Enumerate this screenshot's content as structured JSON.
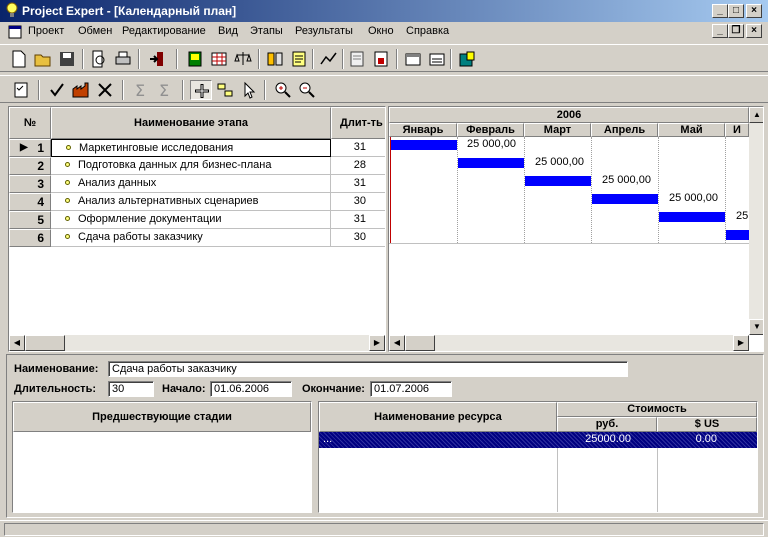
{
  "window": {
    "title": "Project Expert - [Календарный план]"
  },
  "menu": [
    "Проект",
    "Обмен",
    "Редактирование",
    "Вид",
    "Этапы",
    "Результаты",
    "Окно",
    "Справка"
  ],
  "toolbar1_icons": [
    "new-doc-icon",
    "open-folder-icon",
    "save-icon",
    "print-preview-icon",
    "print-icon",
    "import-icon",
    "module-icon",
    "calendar-grid-icon",
    "scales-icon",
    "calculator-icon",
    "notes-icon",
    "chart-icon",
    "report-icon",
    "report-red-icon",
    "window1-icon",
    "window2-icon",
    "database-icon"
  ],
  "toolbar2_icons": [
    "checklist-icon",
    "check-icon",
    "factory-icon",
    "delete-icon",
    "sum-icon",
    "sum2-icon",
    "add-stage-icon",
    "link-stage-icon",
    "pointer-icon",
    "zoom-in-icon",
    "zoom-out-icon"
  ],
  "grid": {
    "headers": {
      "num": "№",
      "name": "Наименование этапа",
      "duration": "Длит-ть"
    },
    "rows": [
      {
        "num": "1",
        "name": "Маркетинговые исследования",
        "duration": "31"
      },
      {
        "num": "2",
        "name": "Подготовка данных для бизнес-плана",
        "duration": "28"
      },
      {
        "num": "3",
        "name": "Анализ данных",
        "duration": "31"
      },
      {
        "num": "4",
        "name": "Анализ альтернативных сценариев",
        "duration": "30"
      },
      {
        "num": "5",
        "name": "Оформление документации",
        "duration": "31"
      },
      {
        "num": "6",
        "name": "Сдача работы заказчику",
        "duration": "30"
      }
    ]
  },
  "gantt": {
    "year": "2006",
    "months": [
      "Январь",
      "Февраль",
      "Март",
      "Апрель",
      "Май",
      "И"
    ],
    "bar_labels": [
      "25 000,00",
      "25 000,00",
      "25 000,00",
      "25 000,00",
      "25"
    ]
  },
  "details": {
    "name_label": "Наименование:",
    "name_value": "Сдача работы заказчику",
    "duration_label": "Длительность:",
    "duration_value": "30",
    "start_label": "Начало:",
    "start_value": "01.06.2006",
    "end_label": "Окончание:",
    "end_value": "01.07.2006"
  },
  "predecessors": {
    "header": "Предшествующие стадии"
  },
  "resources": {
    "header_name": "Наименование ресурса",
    "header_cost": "Стоимость",
    "header_rub": "руб.",
    "header_usd": "$ US",
    "rows": [
      {
        "name": "...",
        "rub": "25000.00",
        "usd": "0.00"
      }
    ]
  }
}
